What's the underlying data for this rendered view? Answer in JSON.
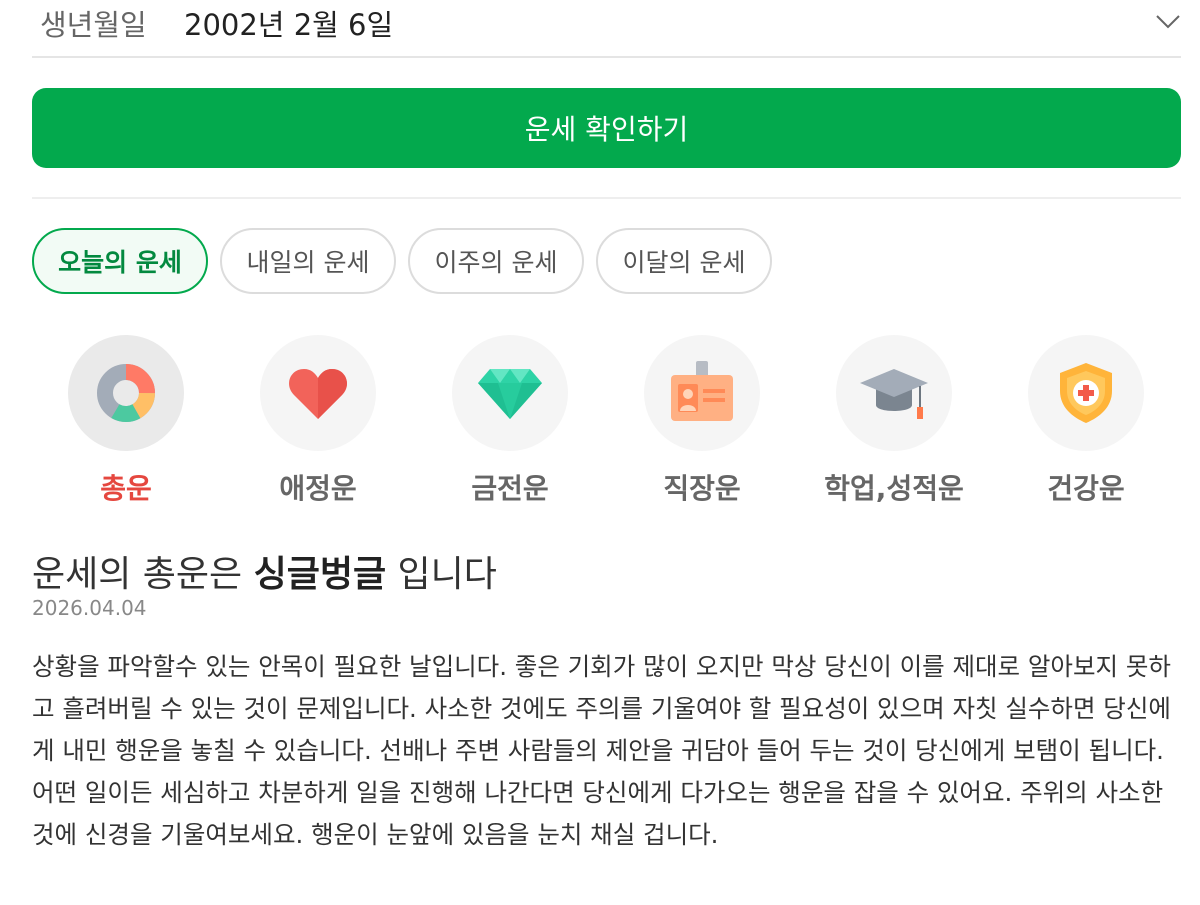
{
  "birth": {
    "label": "생년월일",
    "value": "2002년 2월 6일",
    "dropdown_icon": "chevron-down-icon"
  },
  "check_button": {
    "label": "운세 확인하기",
    "color": "#03a94d"
  },
  "tabs": [
    {
      "label": "오늘의 운세",
      "active": true
    },
    {
      "label": "내일의 운세",
      "active": false
    },
    {
      "label": "이주의 운세",
      "active": false
    },
    {
      "label": "이달의 운세",
      "active": false
    }
  ],
  "categories": [
    {
      "label": "총운",
      "icon": "donut-chart-icon",
      "active": true
    },
    {
      "label": "애정운",
      "icon": "heart-icon",
      "active": false
    },
    {
      "label": "금전운",
      "icon": "diamond-icon",
      "active": false
    },
    {
      "label": "직장운",
      "icon": "id-badge-icon",
      "active": false
    },
    {
      "label": "학업,성적운",
      "icon": "graduation-cap-icon",
      "active": false
    },
    {
      "label": "건강운",
      "icon": "health-shield-icon",
      "active": false
    }
  ],
  "result": {
    "title_prefix": "운세의 총운은 ",
    "title_highlight": "싱글벙글",
    "title_suffix": " 입니다",
    "date": "2026.04.04",
    "body": "상황을 파악할수 있는 안목이 필요한 날입니다. 좋은 기회가 많이 오지만 막상 당신이 이를 제대로 알아보지 못하고 흘려버릴 수 있는 것이 문제입니다. 사소한 것에도 주의를 기울여야 할 필요성이 있으며 자칫 실수하면 당신에게 내민 행운을 놓칠 수 있습니다. 선배나 주변 사람들의 제안을 귀담아 들어 두는 것이 당신에게 보탬이 됩니다. 어떤 일이든 세심하고 차분하게 일을 진행해 나간다면 당신에게 다가오는 행운을 잡을 수 있어요. 주위의 사소한 것에 신경을 기울여보세요. 행운이 눈앞에 있음을 눈치 채실 겁니다."
  }
}
